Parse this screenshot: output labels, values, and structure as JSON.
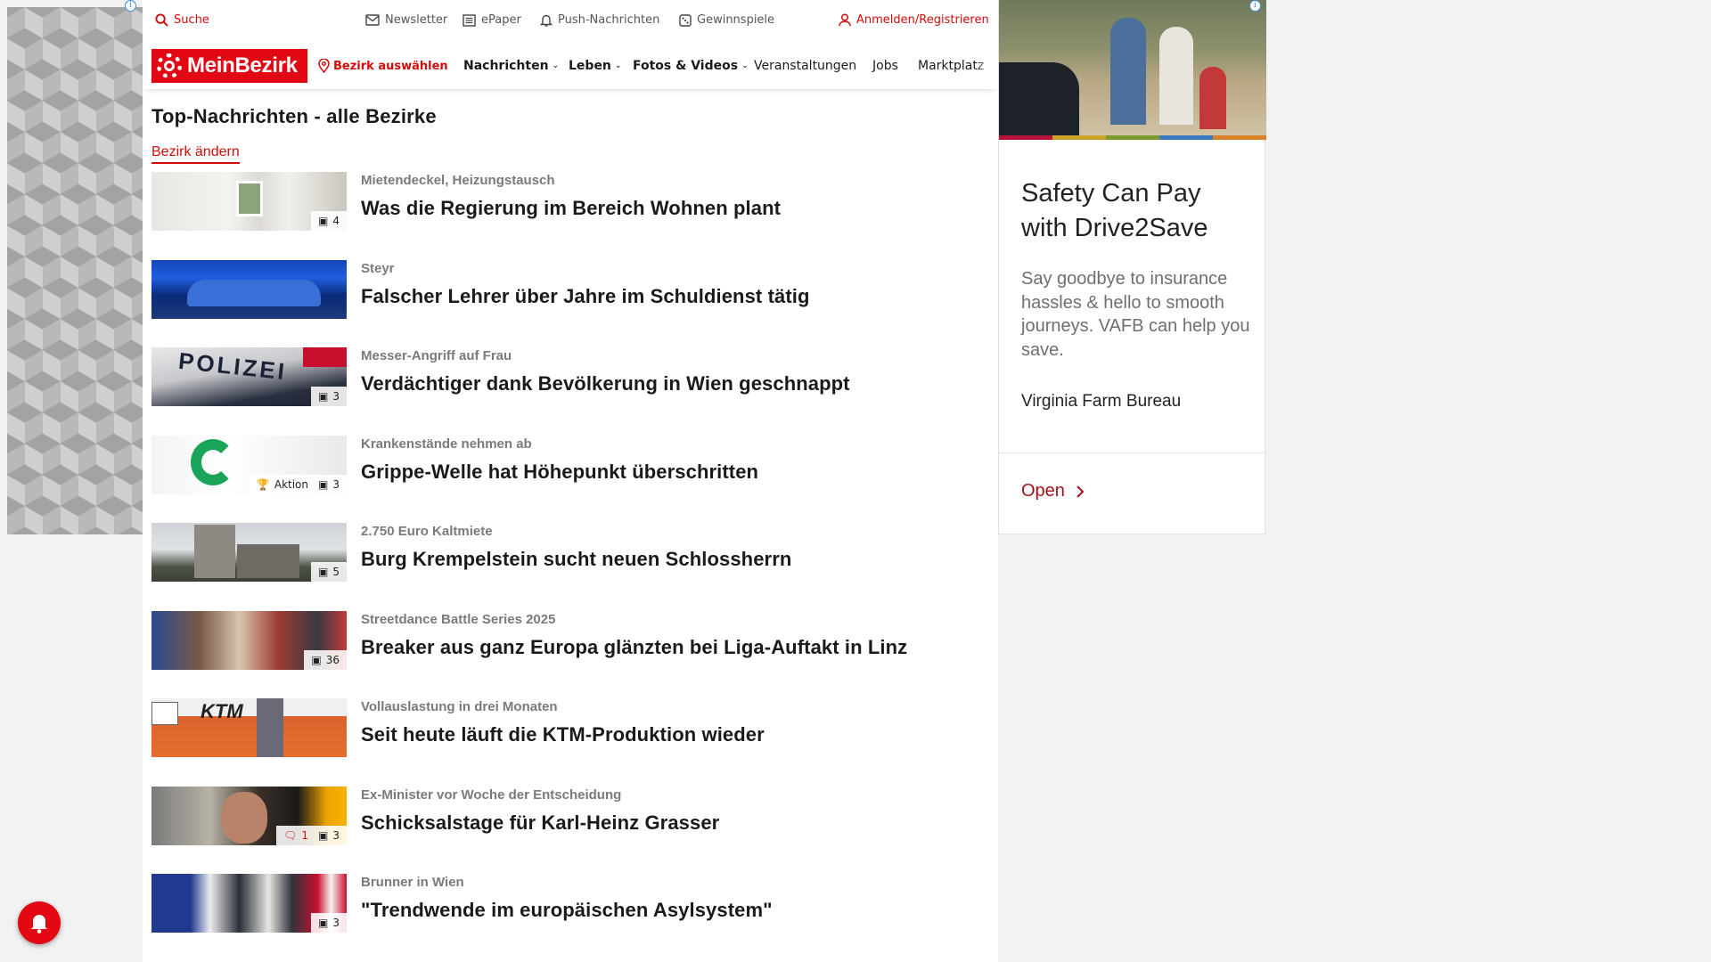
{
  "utility_bar": {
    "search_label": "Suche",
    "newsletter_label": "Newsletter",
    "epaper_label": "ePaper",
    "push_label": "Push-Nachrichten",
    "games_label": "Gewinnspiele",
    "login_label": "Anmelden/Registrieren"
  },
  "navbar": {
    "logo_text": "MeinBezirk",
    "district_label": "Bezirk auswählen",
    "items": [
      {
        "label": "Nachrichten"
      },
      {
        "label": "Leben"
      },
      {
        "label": "Fotos & Videos"
      },
      {
        "label": "Veranstaltungen"
      },
      {
        "label": "Jobs"
      },
      {
        "label": "Marktplatz"
      }
    ]
  },
  "main": {
    "section_title": "Top-Nachrichten - alle Bezirke",
    "change_district_label": "Bezirk ändern",
    "articles": [
      {
        "kicker": "Mietendeckel, Heizungstausch",
        "headline": "Was die Regierung im Bereich Wohnen plant",
        "photo_count": "4"
      },
      {
        "kicker": "Steyr",
        "headline": "Falscher Lehrer über Jahre im Schuldienst tätig"
      },
      {
        "kicker": "Messer-Angriff auf Frau",
        "headline": "Verdächtiger dank Bevölkerung in Wien geschnappt",
        "photo_count": "3"
      },
      {
        "kicker": "Krankenstände nehmen ab",
        "headline": "Grippe-Welle hat Höhepunkt überschritten",
        "photo_count": "3",
        "promo_label": "Aktion"
      },
      {
        "kicker": "2.750 Euro Kaltmiete",
        "headline": "Burg Krempelstein sucht neuen Schlossherrn",
        "photo_count": "5"
      },
      {
        "kicker": "Streetdance Battle Series 2025",
        "headline": "Breaker aus ganz Europa glänzten bei Liga-Auftakt in Linz",
        "photo_count": "36"
      },
      {
        "kicker": "Vollauslastung in drei Monaten",
        "headline": "Seit heute läuft die KTM-Produktion wieder"
      },
      {
        "kicker": "Ex-Minister vor Woche der Entscheidung",
        "headline": "Schicksalstage für Karl-Heinz Grasser",
        "photo_count": "3",
        "comment_count": "1"
      },
      {
        "kicker": "Brunner in Wien",
        "headline": "\"Trendwende im europäischen Asylsystem\"",
        "photo_count": "3"
      }
    ]
  },
  "right_ad": {
    "headline": "Safety Can Pay with Drive2Save",
    "body": "Say goodbye to insurance hassles & hello to smooth journeys. VAFB can help you save.",
    "brand": "Virginia Farm Bureau",
    "cta_label": "Open"
  },
  "colors": {
    "brand_red": "#e30613",
    "link_red": "#d40b0b",
    "ad_cta": "#a3101a"
  }
}
